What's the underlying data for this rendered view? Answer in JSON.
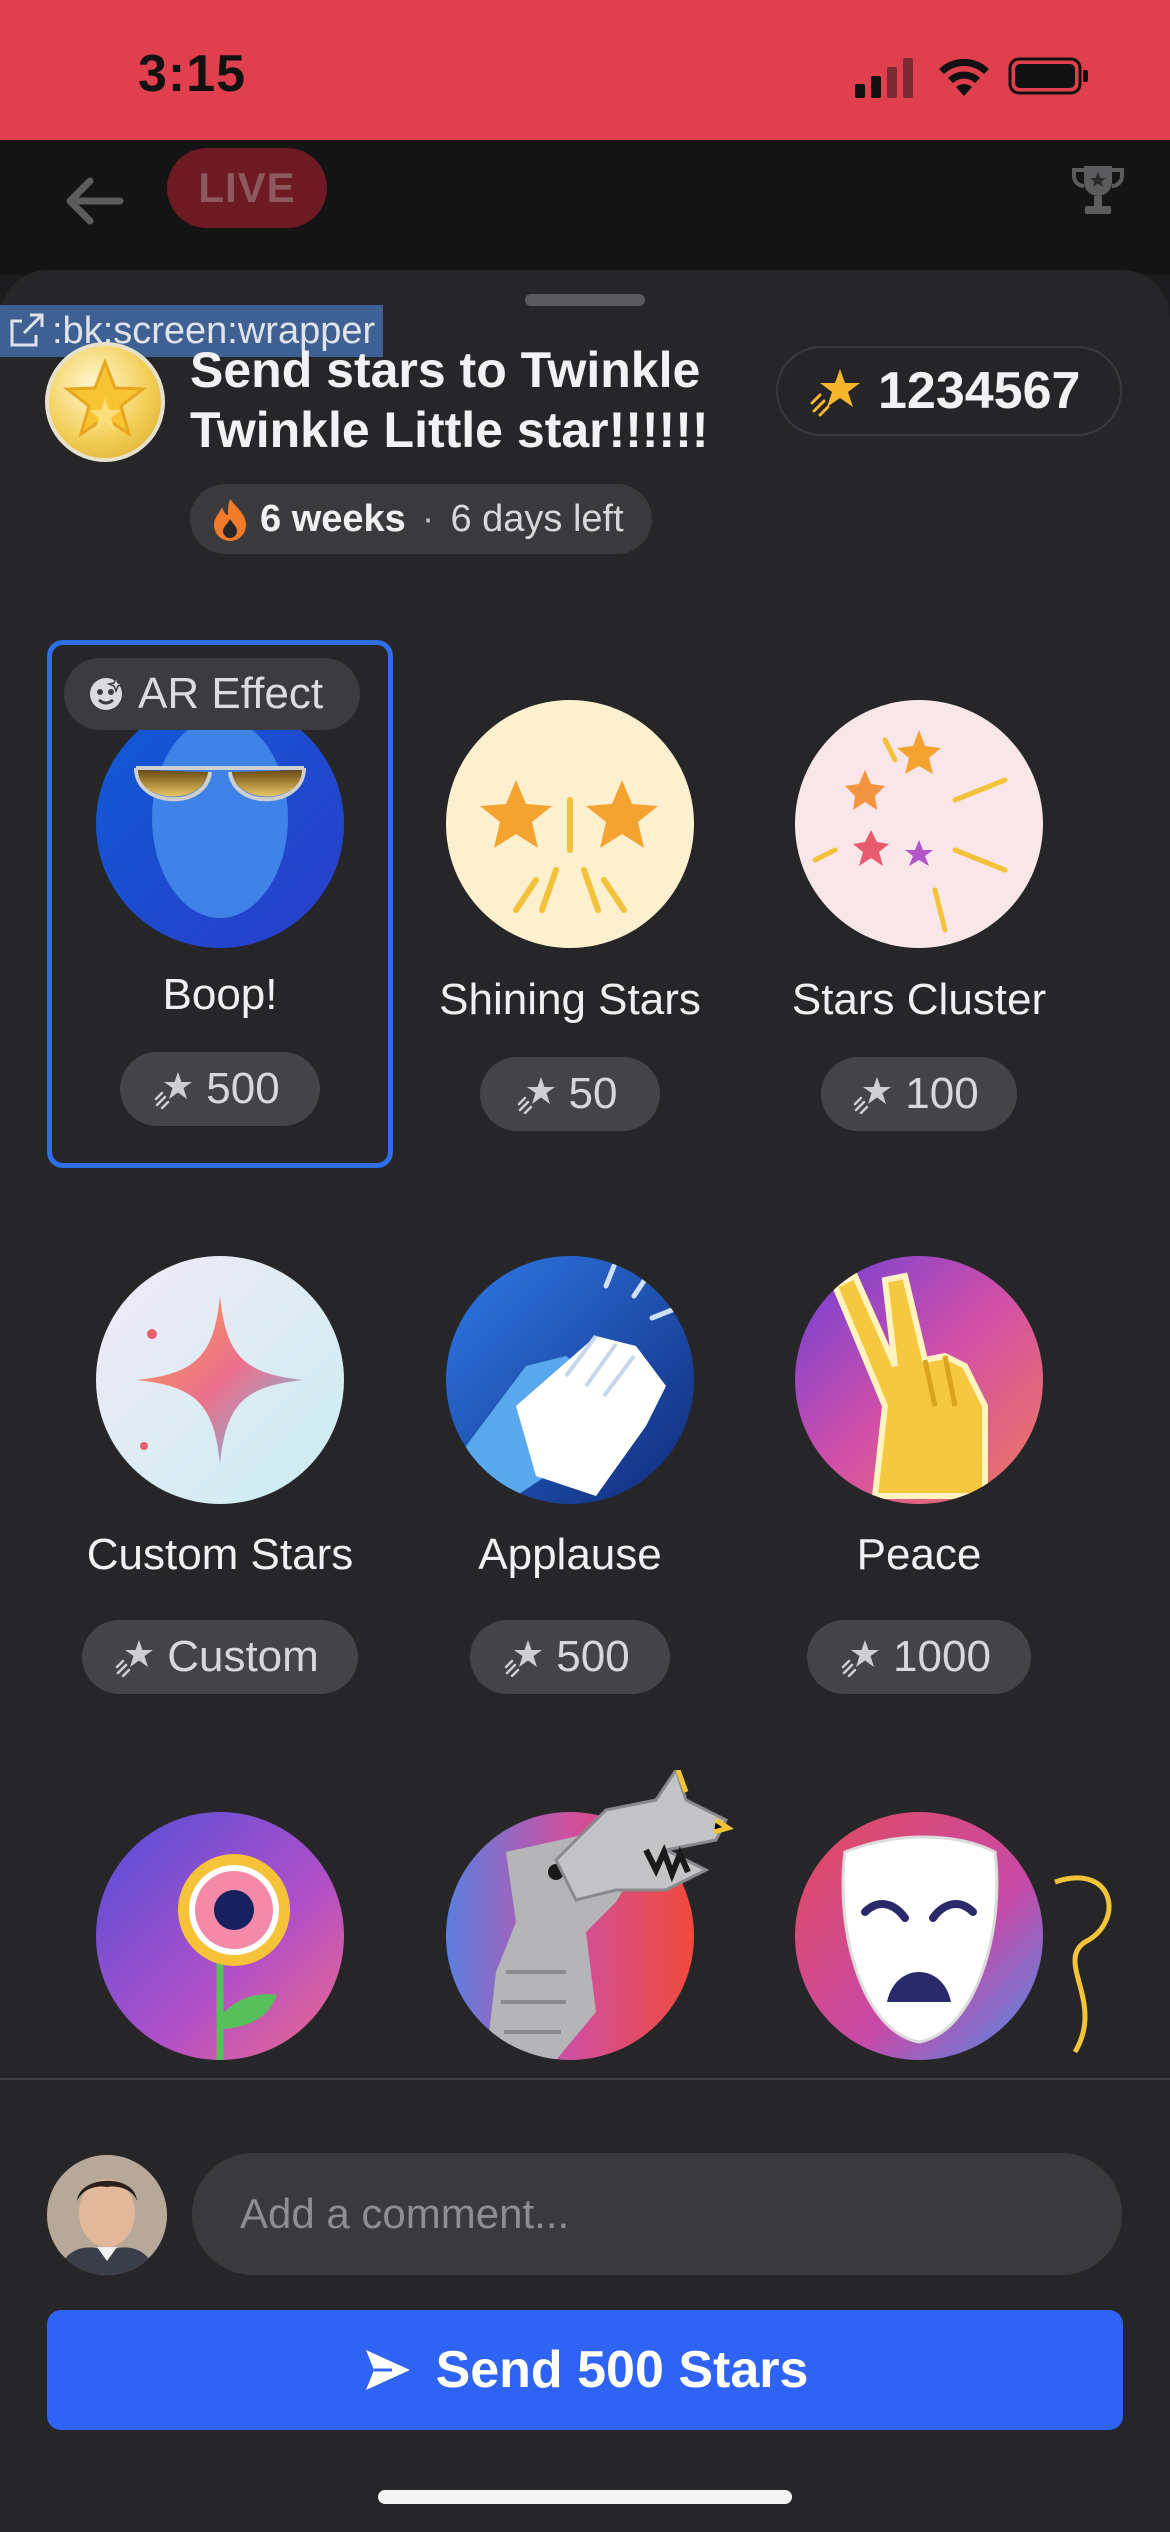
{
  "status_bar": {
    "time": "3:15"
  },
  "top_bar": {
    "live_label": "LIVE"
  },
  "debug": {
    "label": ":bk:screen:wrapper"
  },
  "header": {
    "title": "Send stars to Twinkle Twinkle Little star!!!!!!",
    "balance": "1234567",
    "streak_weeks": "6 weeks",
    "streak_separator": "·",
    "streak_days_left": "6 days left"
  },
  "ar_effect_label": "AR Effect",
  "gifts": [
    {
      "name": "Boop!",
      "price": "500",
      "selected": true
    },
    {
      "name": "Shining Stars",
      "price": "50"
    },
    {
      "name": "Stars Cluster",
      "price": "100"
    },
    {
      "name": "Custom Stars",
      "price": "Custom"
    },
    {
      "name": "Applause",
      "price": "500"
    },
    {
      "name": "Peace",
      "price": "1000"
    },
    {
      "name": "Flower",
      "icon": "flower-icon"
    },
    {
      "name": "Dragon",
      "icon": "dragon-icon"
    },
    {
      "name": "Drama mask",
      "icon": "drama-mask-icon"
    }
  ],
  "comment": {
    "placeholder": "Add a comment..."
  },
  "send_button": {
    "label": "Send 500 Stars"
  },
  "colors": {
    "accent": "#2f63f3",
    "status_bar": "#e0404e",
    "selected_border": "#2f6ee6"
  }
}
